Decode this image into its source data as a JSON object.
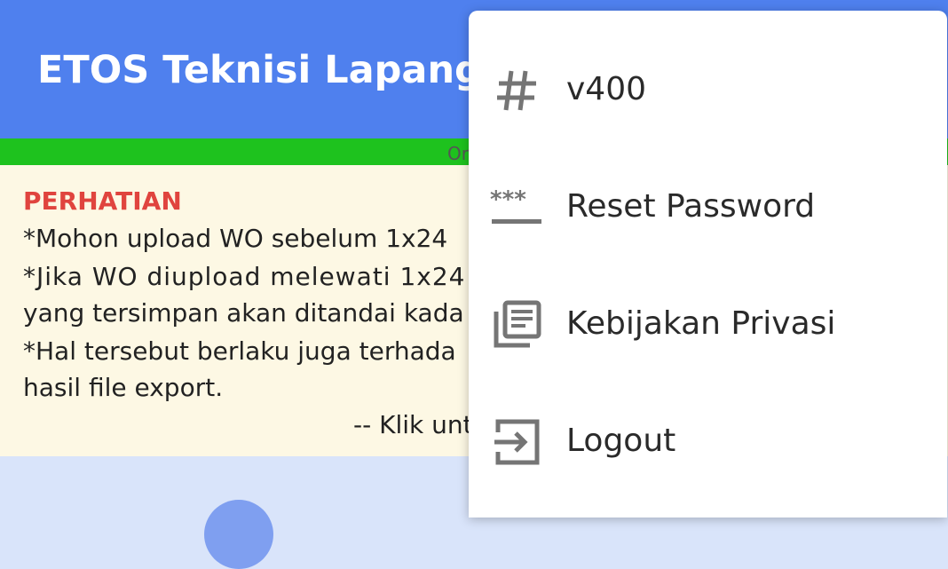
{
  "appbar": {
    "title": "ETOS Teknisi Lapangan",
    "color": "#4f80ee"
  },
  "status_strip": {
    "text": "Or",
    "color": "#1ec21e"
  },
  "notice": {
    "heading": "PERHATIAN",
    "lines": [
      "*Mohon upload WO sebelum 1x24",
      "*Jika WO diupload melewati 1x24",
      "yang tersimpan akan ditandai kada",
      "*Hal tersebut berlaku juga terhada",
      "hasil file export."
    ],
    "link_text": "-- Klik unt"
  },
  "menu": {
    "items": [
      {
        "label": "v400",
        "icon": "hash-icon"
      },
      {
        "label": "Reset Password",
        "icon": "password-icon"
      },
      {
        "label": "Kebijakan Privasi",
        "icon": "library-books-icon"
      },
      {
        "label": "Logout",
        "icon": "logout-icon"
      }
    ]
  }
}
